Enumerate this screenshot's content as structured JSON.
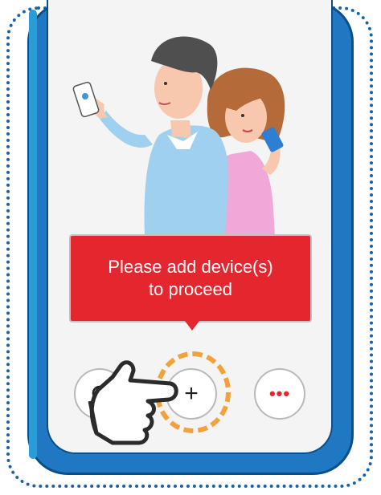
{
  "tooltip": {
    "line1": "Please add device(s)",
    "line2": "to proceed"
  },
  "buttons": {
    "add_symbol": "+",
    "more_symbol": "•••",
    "refresh_icon": "refresh-icon"
  },
  "colors": {
    "frame_blue": "#1763a8",
    "phone_blue": "#1f78c1",
    "tooltip_red": "#e4262f",
    "highlight_orange": "#f2a23a",
    "screen_bg": "#f4f4f4"
  }
}
